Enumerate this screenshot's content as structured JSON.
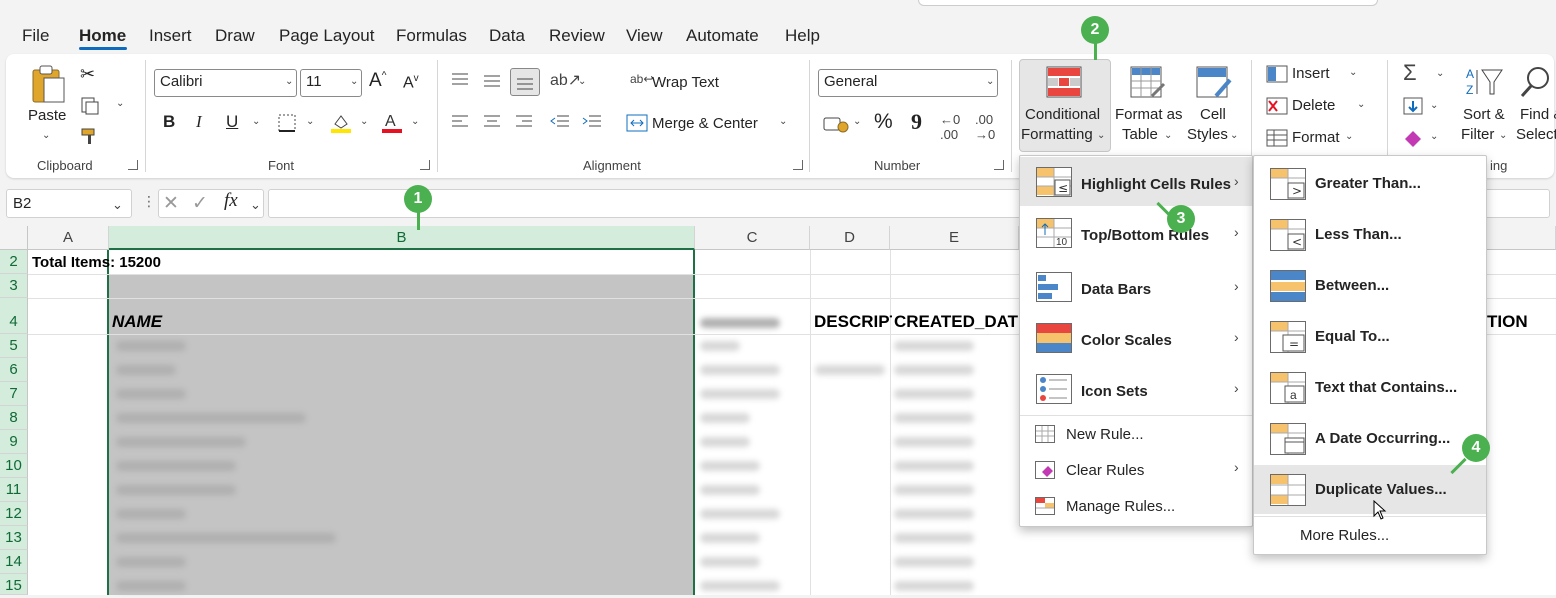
{
  "menu_tabs": [
    "File",
    "Home",
    "Insert",
    "Draw",
    "Page Layout",
    "Formulas",
    "Data",
    "Review",
    "View",
    "Automate",
    "Help"
  ],
  "ribbon": {
    "clipboard": {
      "paste": "Paste",
      "label": "Clipboard"
    },
    "font": {
      "name": "Calibri",
      "size": "11",
      "label": "Font",
      "bold": "B",
      "italic": "I",
      "underline": "U"
    },
    "alignment": {
      "wrap_text": "Wrap Text",
      "merge_center": "Merge & Center",
      "label": "Alignment"
    },
    "number": {
      "format": "General",
      "label": "Number",
      "percent": "%",
      "comma": "9",
      "inc_dec": ".00",
      "dec_dec": ".00"
    },
    "styles": {
      "cf_line1": "Conditional",
      "cf_line2": "Formatting",
      "fat_line1": "Format as",
      "fat_line2": "Table",
      "cs_line1": "Cell",
      "cs_line2": "Styles"
    },
    "cells": {
      "insert": "Insert",
      "delete": "Delete",
      "format": "Format"
    },
    "editing": {
      "sort_line1": "Sort &",
      "sort_line2": "Filter",
      "find_line1": "Find &",
      "find_line2": "Select",
      "label_partial": "ing"
    }
  },
  "formula_bar": {
    "name_box": "B2",
    "fx": "fx",
    "value": ""
  },
  "grid": {
    "columns": [
      "A",
      "B",
      "C",
      "D",
      "E"
    ],
    "rows": [
      "2",
      "3",
      "4",
      "5",
      "6",
      "7",
      "8",
      "9",
      "10",
      "11",
      "12",
      "13",
      "14",
      "15"
    ],
    "cell_b2": "Total Items: 15200",
    "b4": "NAME",
    "d4": "DESCRIPT",
    "e4": "CREATED_DATE",
    "far_right_header": "TION"
  },
  "menu_cf": {
    "items": [
      "Highlight Cells Rules",
      "Top/Bottom Rules",
      "Data Bars",
      "Color Scales",
      "Icon Sets",
      "New Rule...",
      "Clear Rules",
      "Manage Rules..."
    ]
  },
  "menu_highlight": {
    "items": [
      "Greater Than...",
      "Less Than...",
      "Between...",
      "Equal To...",
      "Text that Contains...",
      "A Date Occurring...",
      "Duplicate Values...",
      "More Rules..."
    ]
  },
  "badges": [
    "1",
    "2",
    "3",
    "4"
  ],
  "colors": {
    "accent": "#0f6cbd",
    "badge": "#4bb04f",
    "selection": "#d3ecdb",
    "excel_green": "#1e7145"
  }
}
